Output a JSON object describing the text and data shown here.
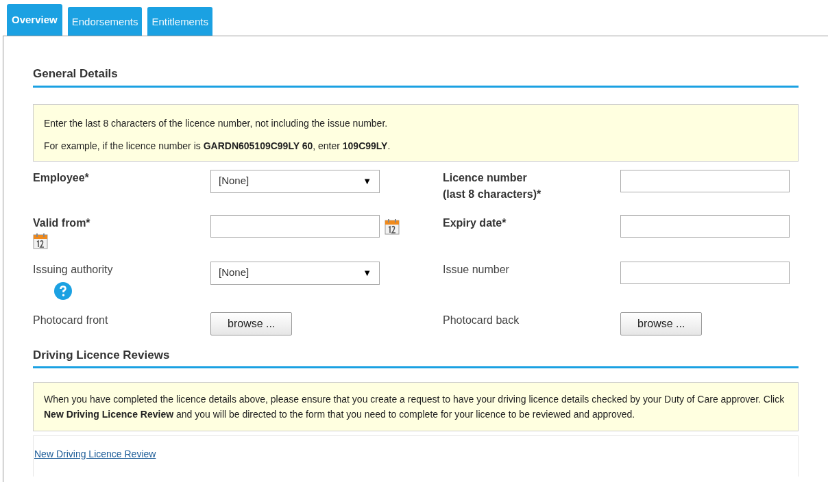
{
  "tabs": [
    {
      "label": "Overview",
      "selected": true
    },
    {
      "label": "Endorsements",
      "selected": false
    },
    {
      "label": "Entitlements",
      "selected": false
    }
  ],
  "general_details": {
    "heading": "General Details",
    "info": [
      "Enter the last 8 characters of the licence number, not including the issue number.",
      "For example, if the licence number is **GARDN605109C99LY 60**, enter **109C99LY**."
    ],
    "rows": [
      {
        "left": {
          "label": "Employee*",
          "required": true,
          "kind": "select",
          "value": "[None]",
          "caret": "▼"
        },
        "right": {
          "label": "Licence number",
          "sublabel": "(last 8 characters)*",
          "required": true,
          "kind": "text"
        }
      },
      {
        "left": {
          "label": "Valid from*",
          "required": true,
          "kind": "date",
          "calendar_icon": true
        },
        "right": {
          "label": "Expiry date*",
          "required": true,
          "kind": "text"
        }
      },
      {
        "left": {
          "label": "Issuing authority",
          "required": false,
          "kind": "select",
          "value": "[None]",
          "caret": "▼",
          "help_icon": true
        },
        "right": {
          "label": "Issue number",
          "required": false,
          "kind": "text"
        }
      },
      {
        "left": {
          "label": "Photocard front",
          "required": false,
          "kind": "file",
          "button": "browse ..."
        },
        "right": {
          "label": "Photocard back",
          "required": false,
          "kind": "file",
          "button": "browse ..."
        }
      }
    ]
  },
  "reviews": {
    "heading": "Driving Licence Reviews",
    "info": "When you have completed the licence details above, please ensure that you create a request to have your driving licence details checked by your Duty of Care approver. Click **New Driving Licence Review** and you will be directed to the form that you need to complete for your licence to be reviewed and approved.",
    "link": "New Driving Licence Review"
  }
}
